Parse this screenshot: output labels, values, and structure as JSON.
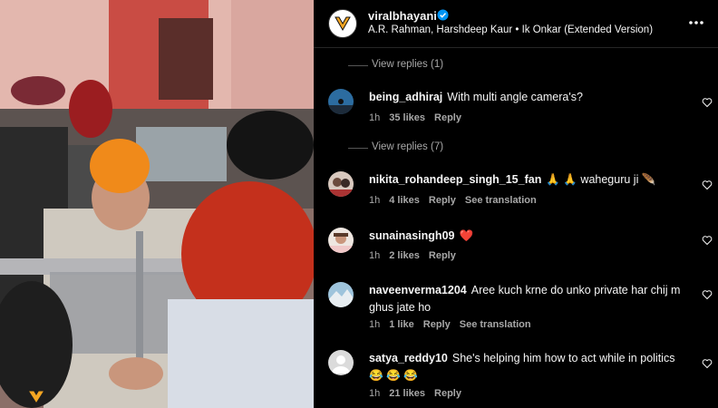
{
  "header": {
    "username": "viralbhayani",
    "audio": "A.R. Rahman, Harshdeep Kaur • Ik Onkar (Extended Version)",
    "avatar_icon": "v-logo-icon",
    "colors": {
      "verified": "#0095f6",
      "brand": "#f5a623"
    }
  },
  "view_replies": [
    {
      "label": "View replies (1)"
    },
    {
      "label": "View replies (7)"
    }
  ],
  "comments": [
    {
      "username": "being_adhiraj",
      "text": "With multi angle camera's?",
      "time": "1h",
      "likes": "35 likes",
      "reply": "Reply"
    },
    {
      "username": "nikita_rohandeep_singh_15_fan",
      "text": "🙏 🙏  waheguru ji 🪶",
      "time": "1h",
      "likes": "4 likes",
      "reply": "Reply",
      "translation": "See translation"
    },
    {
      "username": "sunainasingh09",
      "text": "❤️",
      "time": "1h",
      "likes": "2 likes",
      "reply": "Reply"
    },
    {
      "username": "naveenverma1204",
      "text": "Aree kuch krne do unko private har chij m ghus jate ho",
      "time": "1h",
      "likes": "1 like",
      "reply": "Reply",
      "translation": "See translation"
    },
    {
      "username": "satya_reddy10",
      "text": "She's helping him how to act while in politics 😂 😂 😂",
      "time": "1h",
      "likes": "21 likes",
      "reply": "Reply"
    }
  ]
}
